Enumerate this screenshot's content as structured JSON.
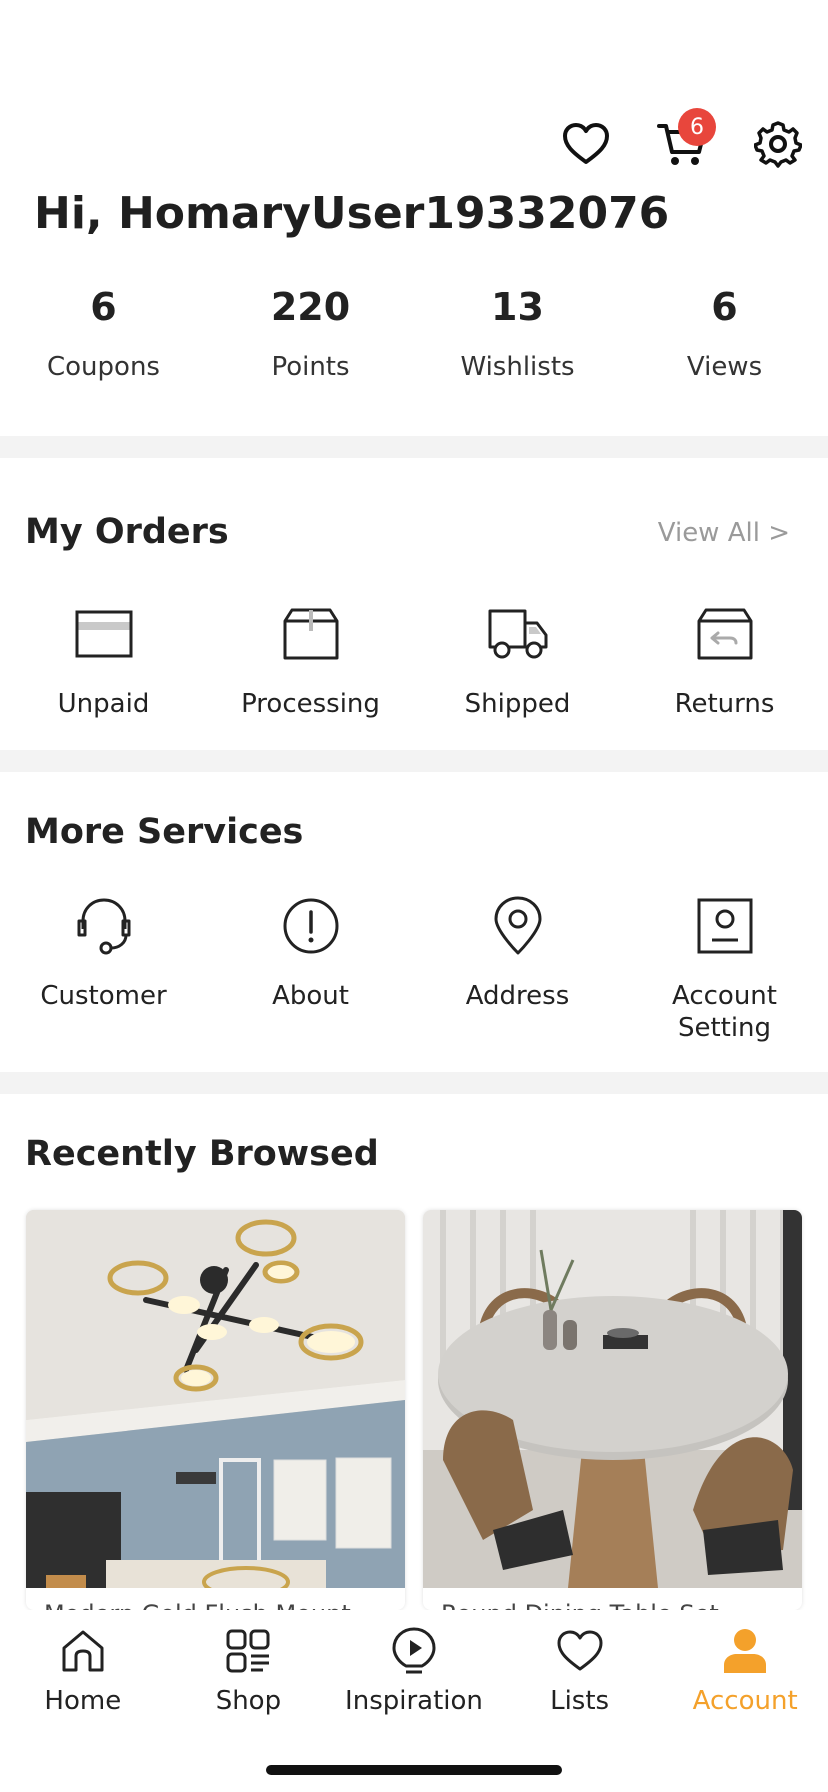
{
  "header": {
    "cart_count": "6"
  },
  "greeting": "Hi, HomaryUser19332076",
  "stats": [
    {
      "value": "6",
      "label": "Coupons"
    },
    {
      "value": "220",
      "label": "Points"
    },
    {
      "value": "13",
      "label": "Wishlists"
    },
    {
      "value": "6",
      "label": "Views"
    }
  ],
  "orders": {
    "title": "My Orders",
    "view_all": "View All >",
    "items": [
      {
        "label": "Unpaid",
        "icon": "card-icon"
      },
      {
        "label": "Processing",
        "icon": "box-icon"
      },
      {
        "label": "Shipped",
        "icon": "truck-icon"
      },
      {
        "label": "Returns",
        "icon": "return-box-icon"
      }
    ]
  },
  "services": {
    "title": "More Services",
    "items": [
      {
        "label": "Customer",
        "icon": "headset-icon"
      },
      {
        "label": "About",
        "icon": "info-icon"
      },
      {
        "label": "Address",
        "icon": "location-pin-icon"
      },
      {
        "label": "Account\nSetting",
        "icon": "account-setting-icon"
      }
    ]
  },
  "recently_browsed": {
    "title": "Recently Browsed",
    "products": [
      {
        "title": "Modern Gold Flush Mount...",
        "image": "ceiling-light-image"
      },
      {
        "title": "Round Dining Table Set...",
        "image": "dining-table-image"
      }
    ]
  },
  "nav": {
    "items": [
      {
        "label": "Home",
        "icon": "home-icon"
      },
      {
        "label": "Shop",
        "icon": "shop-grid-icon"
      },
      {
        "label": "Inspiration",
        "icon": "lightbulb-icon"
      },
      {
        "label": "Lists",
        "icon": "heart-icon"
      },
      {
        "label": "Account",
        "icon": "account-icon",
        "active": true
      }
    ]
  },
  "colors": {
    "accent": "#f4a12b",
    "badge": "#e8463c",
    "divider": "#f3f3f3"
  }
}
